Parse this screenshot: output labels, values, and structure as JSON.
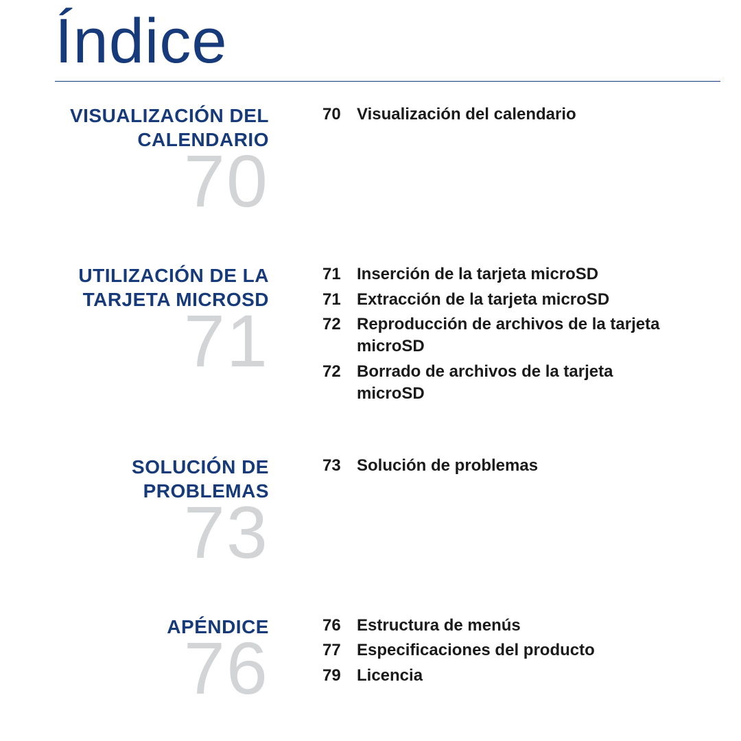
{
  "title": "Índice",
  "sections": [
    {
      "heading": "VISUALIZACIÓN DEL CALENDARIO",
      "page": "70",
      "entries": [
        {
          "page": "70",
          "title": "Visualización del calendario"
        }
      ]
    },
    {
      "heading": "UTILIZACIÓN DE LA TARJETA MICROSD",
      "page": "71",
      "entries": [
        {
          "page": "71",
          "title": "Inserción de la tarjeta microSD"
        },
        {
          "page": "71",
          "title": "Extracción de la tarjeta microSD"
        },
        {
          "page": "72",
          "title": "Reproducción de archivos de la tarjeta microSD"
        },
        {
          "page": "72",
          "title": "Borrado de archivos de la tarjeta microSD"
        }
      ]
    },
    {
      "heading": "SOLUCIÓN DE PROBLEMAS",
      "page": "73",
      "entries": [
        {
          "page": "73",
          "title": "Solución de problemas"
        }
      ]
    },
    {
      "heading": "APÉNDICE",
      "page": "76",
      "entries": [
        {
          "page": "76",
          "title": "Estructura de menús"
        },
        {
          "page": "77",
          "title": "Especificaciones del producto"
        },
        {
          "page": "79",
          "title": "Licencia"
        }
      ]
    }
  ]
}
